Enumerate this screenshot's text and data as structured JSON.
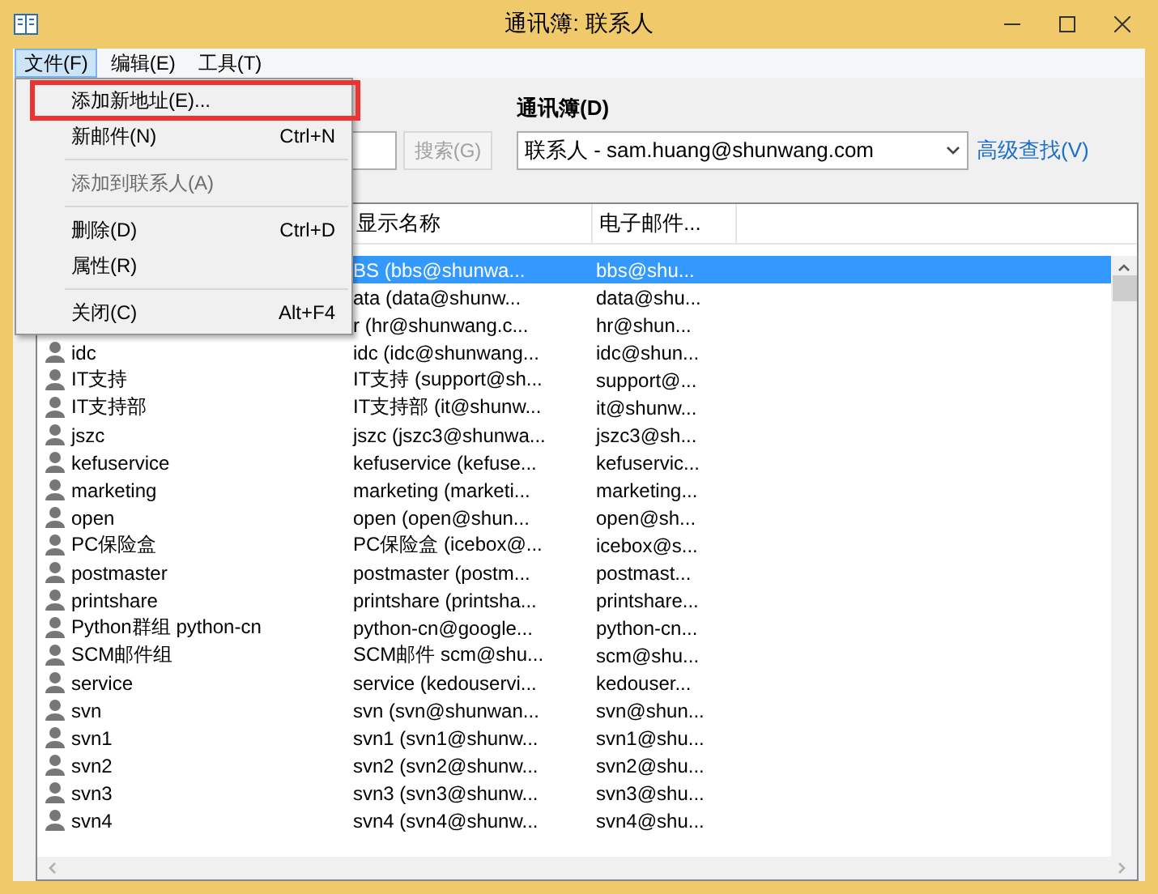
{
  "window": {
    "title": "通讯簿: 联系人"
  },
  "menu_bar": [
    {
      "label": "文件(F)",
      "selected": true
    },
    {
      "label": "编辑(E)",
      "selected": false
    },
    {
      "label": "工具(T)",
      "selected": false
    }
  ],
  "file_menu": [
    {
      "kind": "item",
      "label": "添加新地址(E)...",
      "disabled": false
    },
    {
      "kind": "item",
      "label": "新邮件(N)",
      "shortcut": "Ctrl+N",
      "disabled": false
    },
    {
      "kind": "separator"
    },
    {
      "kind": "item",
      "label": "添加到联系人(A)",
      "disabled": true
    },
    {
      "kind": "separator"
    },
    {
      "kind": "item",
      "label": "删除(D)",
      "shortcut": "Ctrl+D",
      "disabled": false
    },
    {
      "kind": "item",
      "label": "属性(R)",
      "disabled": false
    },
    {
      "kind": "separator"
    },
    {
      "kind": "item",
      "label": "关闭(C)",
      "shortcut": "Alt+F4",
      "disabled": false
    }
  ],
  "search": {
    "button": "搜索(G)",
    "button_disabled": true
  },
  "address_book": {
    "label": "通讯簿(D)",
    "value": "联系人 - sam.huang@shunwang.com"
  },
  "advanced_search": "高级查找(V)",
  "table": {
    "columns": [
      "显示名称",
      "电子邮件..."
    ],
    "rows": [
      {
        "display": "BS (bbs@shunwa...",
        "email": "bbs@shu...",
        "selected": true
      },
      {
        "display": "ata (data@shunw...",
        "email": "data@shu...",
        "selected": false
      },
      {
        "display": "r (hr@shunwang.c...",
        "email": "hr@shun...",
        "selected": false
      },
      {
        "name": "idc",
        "display": "idc (idc@shunwang...",
        "email": "idc@shun...",
        "selected": false
      },
      {
        "name": "IT支持",
        "display": "IT支持 (support@sh...",
        "email": "support@...",
        "selected": false
      },
      {
        "name": "IT支持部",
        "display": "IT支持部 (it@shunw...",
        "email": "it@shunw...",
        "selected": false
      },
      {
        "name": "jszc",
        "display": "jszc (jszc3@shunwa...",
        "email": "jszc3@sh...",
        "selected": false
      },
      {
        "name": "kefuservice",
        "display": "kefuservice (kefuse...",
        "email": "kefuservic...",
        "selected": false
      },
      {
        "name": "marketing",
        "display": "marketing (marketi...",
        "email": "marketing...",
        "selected": false
      },
      {
        "name": "open",
        "display": "open (open@shun...",
        "email": "open@sh...",
        "selected": false
      },
      {
        "name": "PC保险盒",
        "display": "PC保险盒 (icebox@...",
        "email": "icebox@s...",
        "selected": false
      },
      {
        "name": "postmaster",
        "display": "postmaster (postm...",
        "email": "postmast...",
        "selected": false
      },
      {
        "name": "printshare",
        "display": "printshare (printsha...",
        "email": "printshare...",
        "selected": false
      },
      {
        "name": "Python群组 python-cn",
        "display": "python-cn@google...",
        "email": "python-cn...",
        "selected": false
      },
      {
        "name": "SCM邮件组",
        "display": "SCM邮件 scm@shu...",
        "email": "scm@shu...",
        "selected": false
      },
      {
        "name": "service",
        "display": "service (kedouservi...",
        "email": "kedouser...",
        "selected": false
      },
      {
        "name": "svn",
        "display": "svn (svn@shunwan...",
        "email": "svn@shun...",
        "selected": false
      },
      {
        "name": "svn1",
        "display": "svn1 (svn1@shunw...",
        "email": "svn1@shu...",
        "selected": false
      },
      {
        "name": "svn2",
        "display": "svn2 (svn2@shunw...",
        "email": "svn2@shu...",
        "selected": false
      },
      {
        "name": "svn3",
        "display": "svn3 (svn3@shunw...",
        "email": "svn3@shu...",
        "selected": false
      },
      {
        "name": "svn4",
        "display": "svn4 (svn4@shunw...",
        "email": "svn4@shu...",
        "selected": false
      }
    ]
  }
}
